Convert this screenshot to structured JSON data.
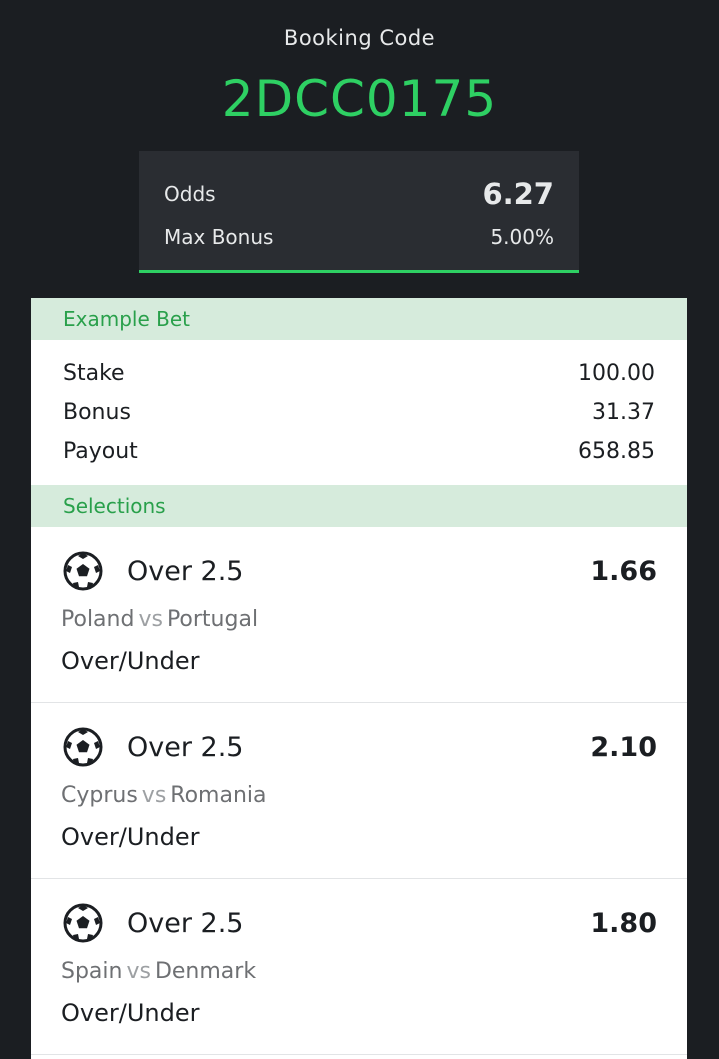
{
  "booking": {
    "label": "Booking Code",
    "code": "2DCC0175"
  },
  "summary": {
    "odds_label": "Odds",
    "odds_value": "6.27",
    "bonus_label": "Max Bonus",
    "bonus_value": "5.00%"
  },
  "example_bet": {
    "heading": "Example Bet",
    "rows": [
      {
        "label": "Stake",
        "value": "100.00"
      },
      {
        "label": "Bonus",
        "value": "31.37"
      },
      {
        "label": "Payout",
        "value": "658.85"
      }
    ]
  },
  "selections": {
    "heading": "Selections",
    "items": [
      {
        "icon": "soccer-ball-icon",
        "market": "Over 2.5",
        "odds": "1.66",
        "home": "Poland",
        "vs": "vs",
        "away": "Portugal",
        "type": "Over/Under"
      },
      {
        "icon": "soccer-ball-icon",
        "market": "Over 2.5",
        "odds": "2.10",
        "home": "Cyprus",
        "vs": "vs",
        "away": "Romania",
        "type": "Over/Under"
      },
      {
        "icon": "soccer-ball-icon",
        "market": "Over 2.5",
        "odds": "1.80",
        "home": "Spain",
        "vs": "vs",
        "away": "Denmark",
        "type": "Over/Under"
      }
    ]
  },
  "colors": {
    "background": "#1b1e22",
    "accent_green": "#2ed063",
    "section_bg": "#d6ebdc",
    "section_text": "#29a04b"
  }
}
